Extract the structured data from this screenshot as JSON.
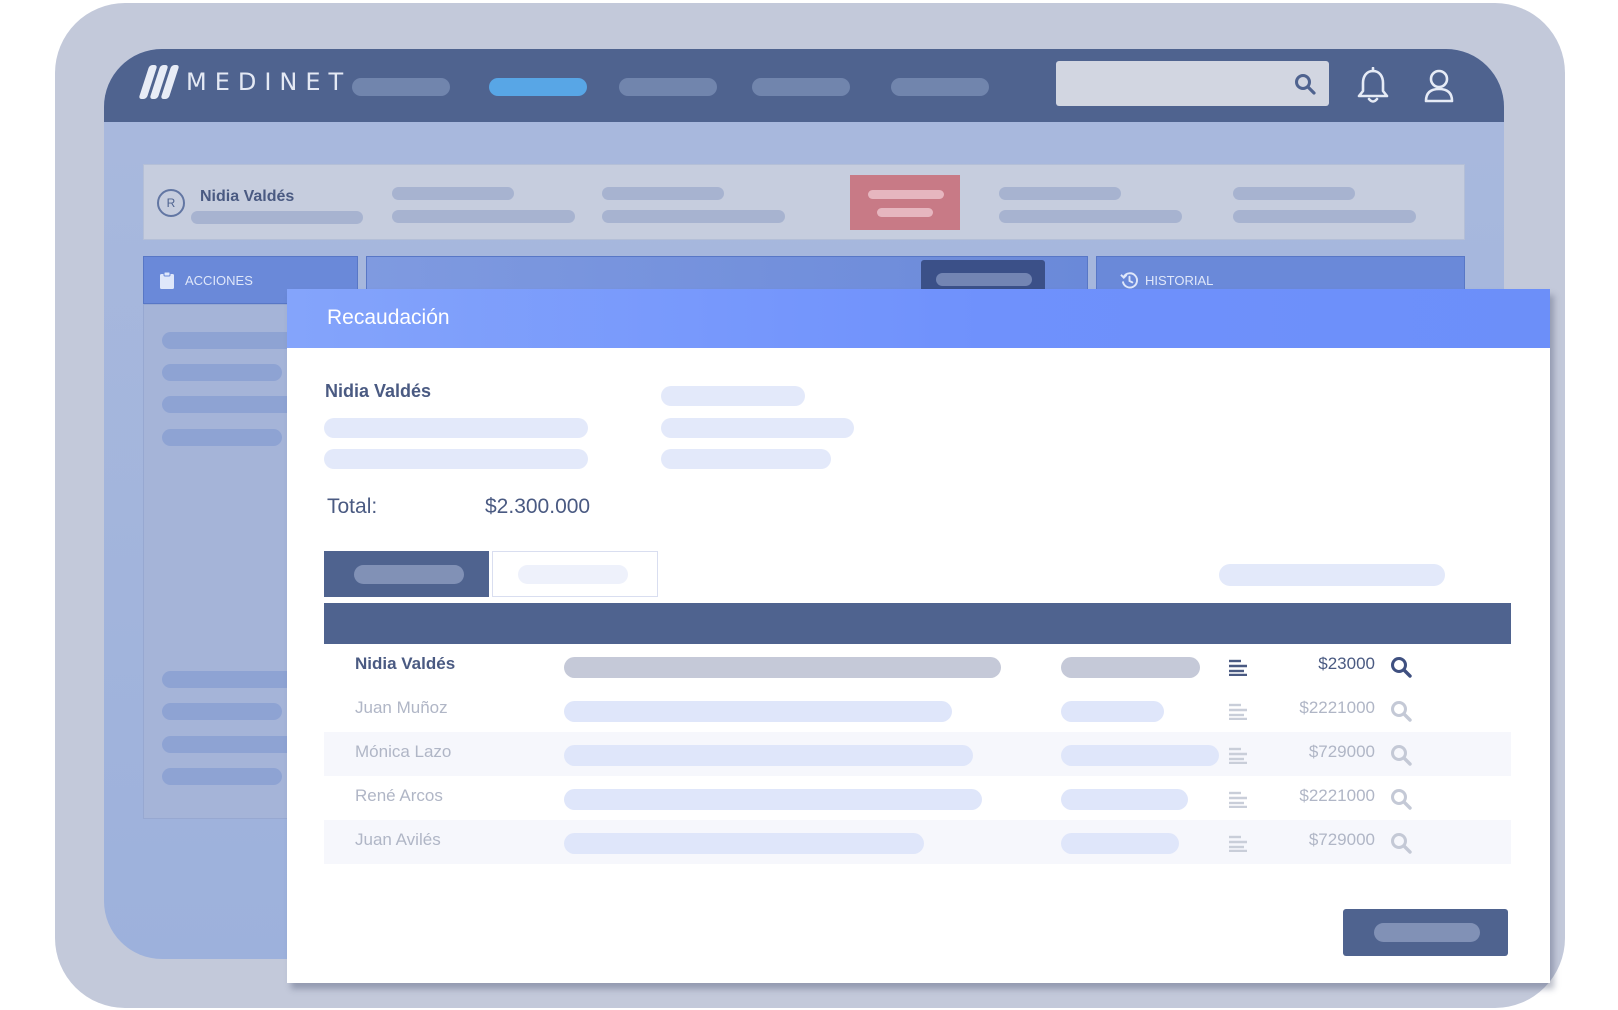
{
  "app": {
    "brand": "MEDINET"
  },
  "patient_card": {
    "initial": "R",
    "name": "Nidia Valdés"
  },
  "panels": {
    "actions_label": "ACCIONES",
    "history_label": "HISTORIAL"
  },
  "modal": {
    "title": "Recaudación",
    "patient_name": "Nidia Valdés",
    "total_label": "Total:",
    "total_value": "$2.300.000",
    "rows": [
      {
        "name": "Nidia Valdés",
        "amount": "$23000",
        "highlighted": true
      },
      {
        "name": "Juan Muñoz",
        "amount": "$2221000",
        "highlighted": false
      },
      {
        "name": "Mónica Lazo",
        "amount": "$729000",
        "highlighted": false
      },
      {
        "name": "René Arcos",
        "amount": "$2221000",
        "highlighted": false
      },
      {
        "name": "Juan Avilés",
        "amount": "$729000",
        "highlighted": false
      }
    ]
  },
  "colors": {
    "primary": "#4f638f",
    "header_blue": "#6f91fc",
    "active_nav": "#58a6e6",
    "alert": "#c87a86"
  },
  "icons": [
    "search-icon",
    "bell-icon",
    "user-icon",
    "clipboard-icon",
    "history-icon",
    "document-lines-icon",
    "magnifier-icon"
  ]
}
